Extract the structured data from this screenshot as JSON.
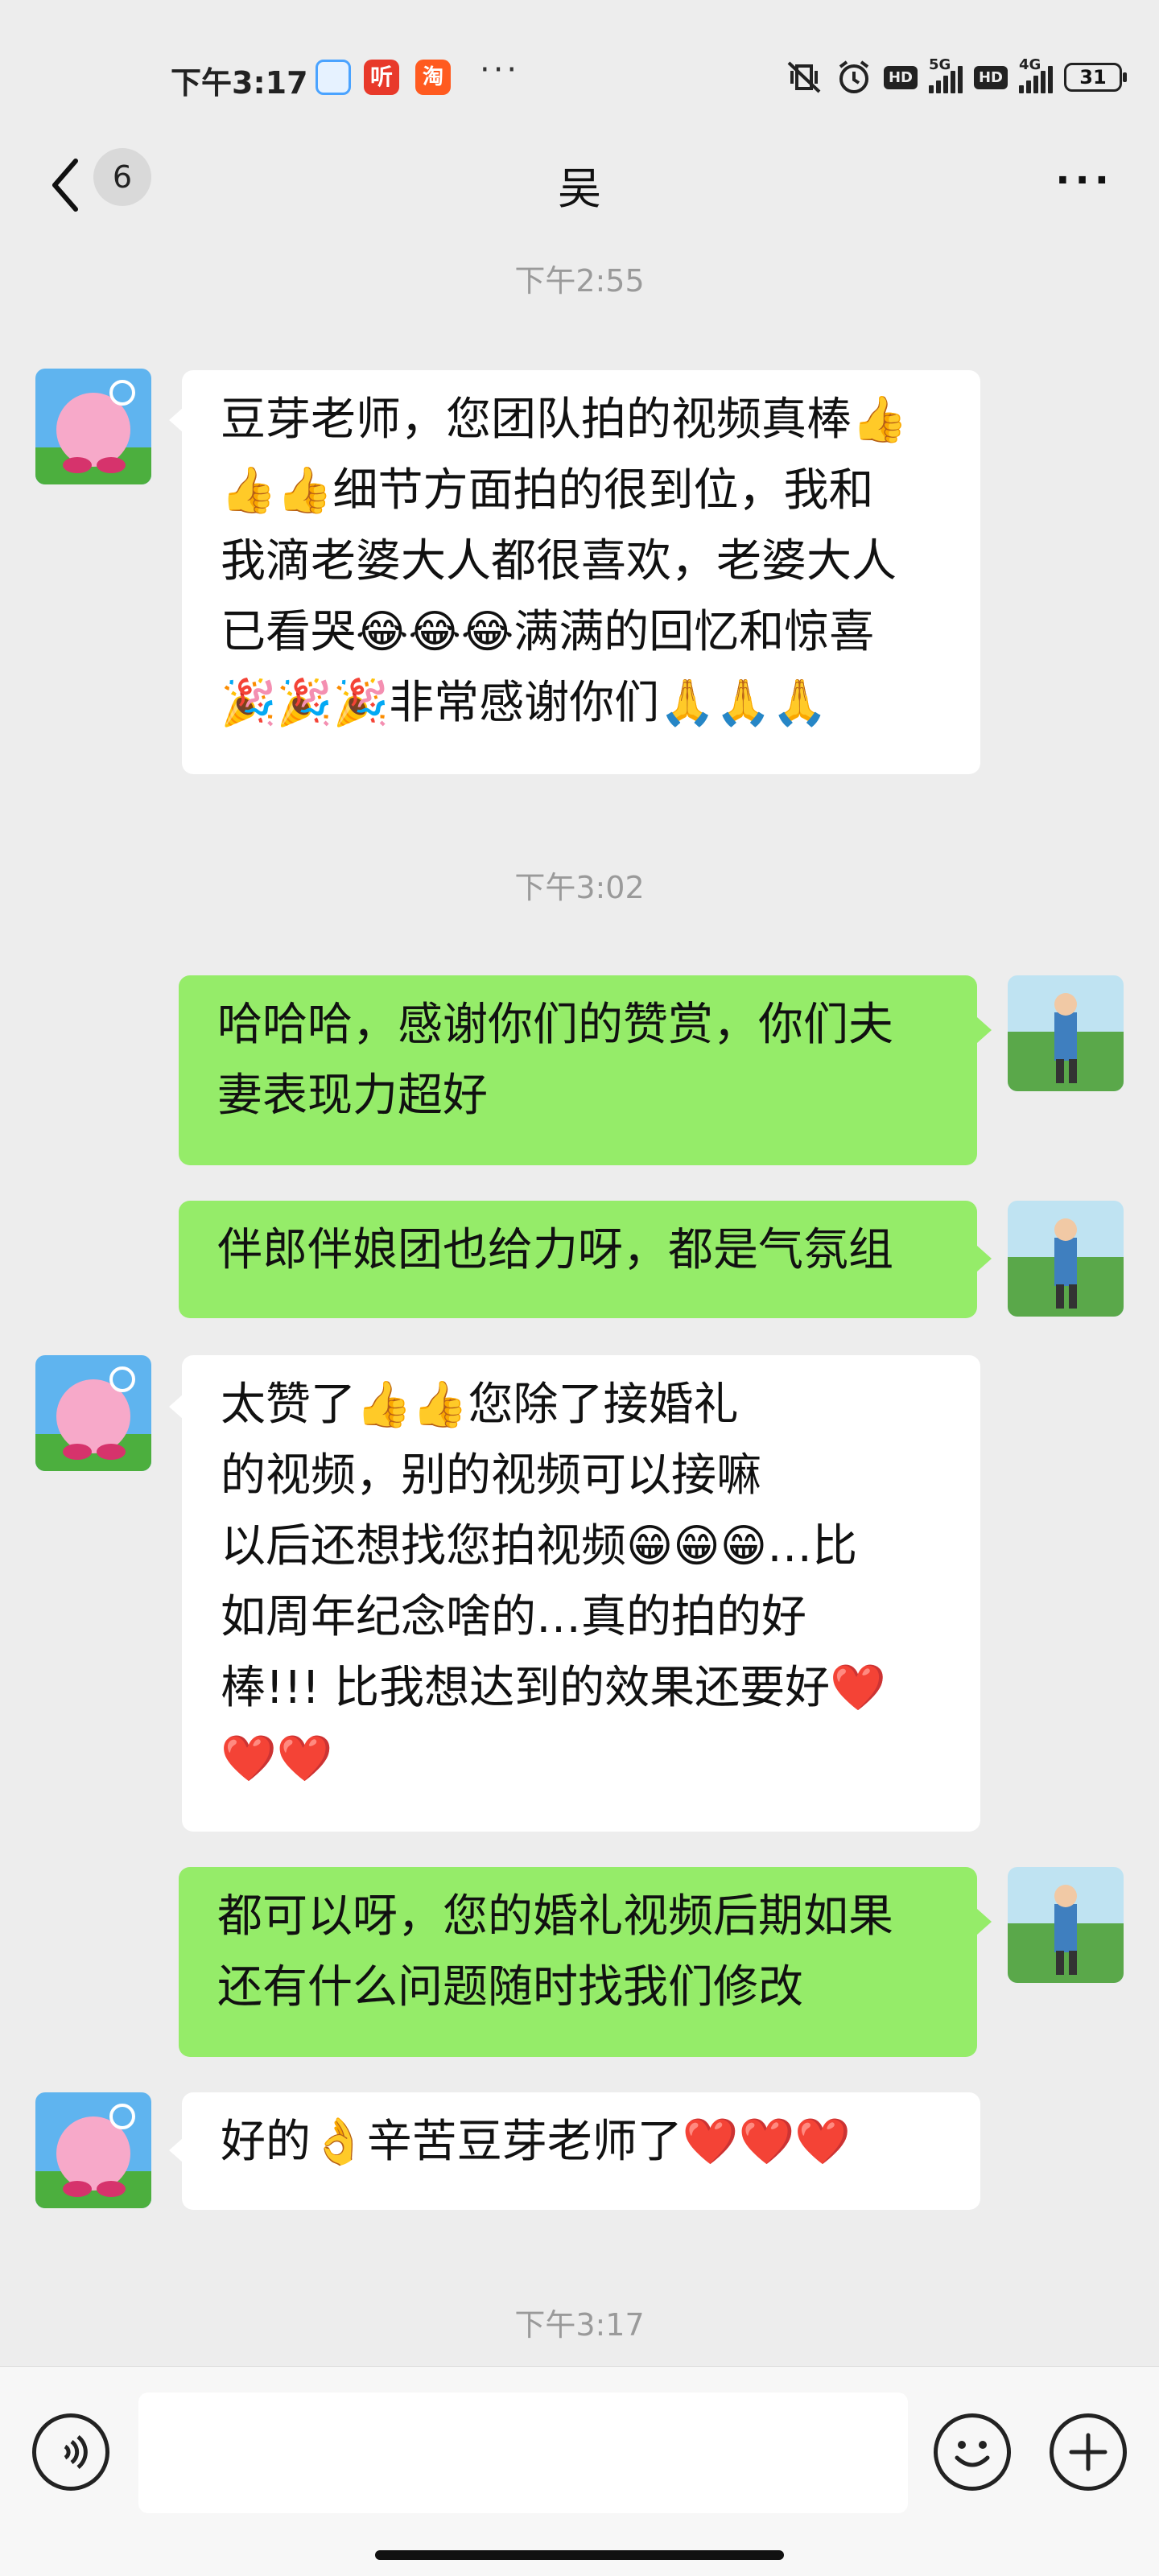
{
  "status_bar": {
    "time": "下午3:17",
    "app_icons": [
      "notification-app-icon",
      "listen-app-icon",
      "shopping-app-icon"
    ],
    "app2_label": "听",
    "app3_label": "淘",
    "more": "···",
    "hd1": "HD",
    "net1": "5G",
    "hd2": "HD",
    "net2": "4G",
    "battery": "31"
  },
  "header": {
    "unread_count": "6",
    "title": "吴",
    "more": "···"
  },
  "messages": {
    "t1": "下午2:55",
    "m1": {
      "lines": [
        "豆芽老师，您团队拍的视频真棒👍",
        "👍👍细节方面拍的很到位，我和",
        "我滴老婆大人都很喜欢，老婆大人",
        "已看哭😂😂😂满满的回忆和惊喜",
        "🎉🎉🎉非常感谢你们🙏🙏🙏"
      ]
    },
    "t2": "下午3:02",
    "m2": {
      "lines": [
        "哈哈哈，感谢你们的赞赏，你们夫",
        "妻表现力超好"
      ]
    },
    "m3": {
      "lines": [
        "伴郎伴娘团也给力呀，都是气氛组"
      ]
    },
    "m4": {
      "lines": [
        "太赞了👍👍您除了接婚礼",
        "的视频，别的视频可以接嘛",
        "以后还想找您拍视频😁😁😁…比",
        "如周年纪念啥的…真的拍的好",
        "棒!!! 比我想达到的效果还要好❤️",
        "❤️❤️"
      ]
    },
    "m5": {
      "lines": [
        "都可以呀，您的婚礼视频后期如果",
        "还有什么问题随时找我们修改"
      ]
    },
    "m6": {
      "lines": [
        "好的👌辛苦豆芽老师了❤️❤️❤️"
      ]
    },
    "t3": "下午3:17"
  },
  "input_bar": {
    "placeholder": "",
    "icons": [
      "voice-icon",
      "emoji-icon",
      "plus-icon"
    ]
  },
  "colors": {
    "background": "#ededed",
    "outgoing_bubble": "#95ec69",
    "incoming_bubble": "#ffffff"
  }
}
